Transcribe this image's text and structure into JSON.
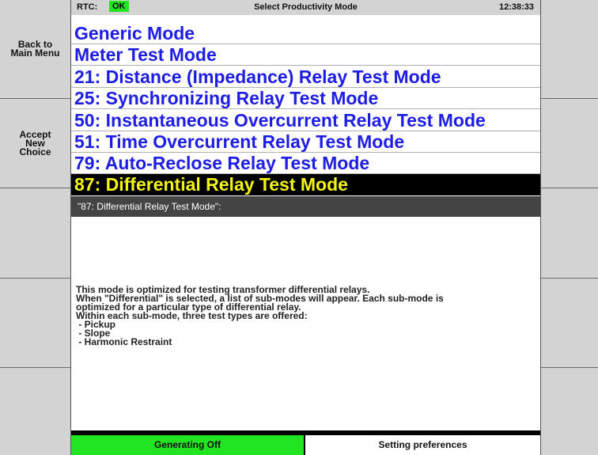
{
  "status": {
    "rtc_label": "RTC:",
    "rtc_status": "OK",
    "title": "Select Productivity Mode",
    "time": "12:38:33"
  },
  "left_softkeys": [
    {
      "label": "Back to\nMain Menu"
    },
    {
      "label": "Accept\nNew\nChoice"
    },
    {
      "label": ""
    },
    {
      "label": ""
    },
    {
      "label": ""
    }
  ],
  "right_softkeys": [
    {
      "label": ""
    },
    {
      "label": ""
    },
    {
      "label": ""
    },
    {
      "label": ""
    },
    {
      "label": ""
    }
  ],
  "modes": [
    {
      "label": "Generic Mode",
      "selected": false
    },
    {
      "label": "Meter Test Mode",
      "selected": false
    },
    {
      "label": "21: Distance (Impedance) Relay Test Mode",
      "selected": false
    },
    {
      "label": "25: Synchronizing Relay Test Mode",
      "selected": false
    },
    {
      "label": "50: Instantaneous Overcurrent Relay Test Mode",
      "selected": false
    },
    {
      "label": "51: Time Overcurrent Relay Test Mode",
      "selected": false
    },
    {
      "label": "79: Auto-Reclose Relay Test Mode",
      "selected": false
    },
    {
      "label": "87: Differential Relay Test Mode",
      "selected": true
    }
  ],
  "description": {
    "header": "\"87: Differential Relay Test Mode\":",
    "lines": [
      "This mode is optimized for testing transformer differential relays.",
      "When \"Differential\" is selected, a list of sub-modes will appear. Each sub-mode is",
      "optimized for a particular type of differential relay.",
      "Within each sub-mode, three test types are offered:",
      " - Pickup",
      " - Slope",
      " - Harmonic Restraint"
    ]
  },
  "footer": {
    "generating": "Generating Off",
    "preferences": "Setting preferences"
  },
  "colors": {
    "ok_green": "#22e522",
    "mode_blue": "#1d1de6",
    "selected_bg": "#000000",
    "selected_fg": "#f4f414"
  }
}
